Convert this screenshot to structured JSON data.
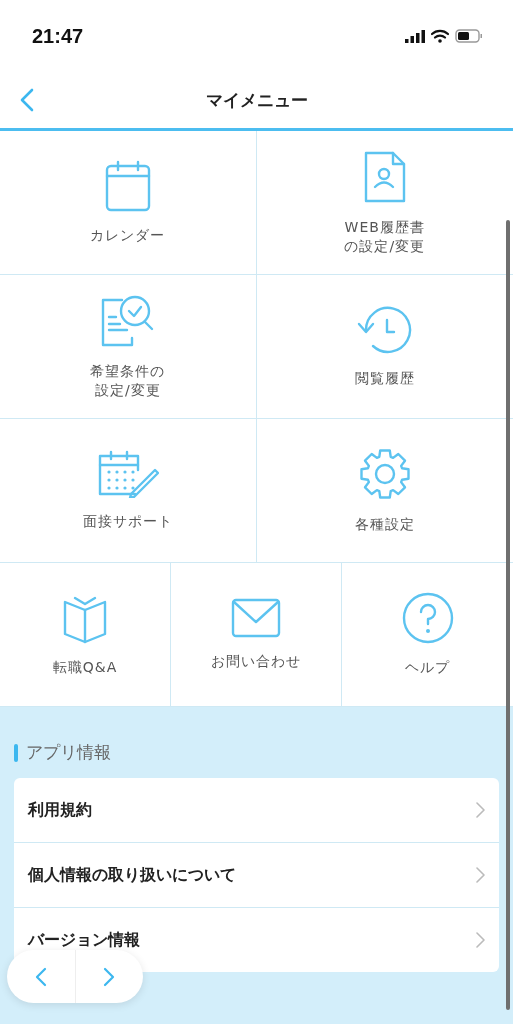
{
  "status_bar": {
    "time": "21:47"
  },
  "nav_bar": {
    "title": "マイメニュー"
  },
  "menu_rows": [
    [
      {
        "kind": "calendar",
        "label": "カレンダー"
      },
      {
        "kind": "resume",
        "label": [
          "WEB履歴書",
          "の設定/変更"
        ]
      }
    ],
    [
      {
        "kind": "search-doc",
        "label": [
          "希望条件の",
          "設定/変更"
        ]
      },
      {
        "kind": "history",
        "label": "閲覧履歴"
      }
    ],
    [
      {
        "kind": "schedule",
        "label": "面接サポート"
      },
      {
        "kind": "gear",
        "label": "各種設定"
      }
    ],
    [
      {
        "kind": "book",
        "label": "転職Q&A"
      },
      {
        "kind": "mail",
        "label": "お問い合わせ"
      },
      {
        "kind": "help",
        "label": "ヘルプ"
      }
    ]
  ],
  "app_info": {
    "heading": "アプリ情報",
    "items": [
      "利用規約",
      "個人情報の取り扱いについて",
      "バージョン情報"
    ]
  }
}
